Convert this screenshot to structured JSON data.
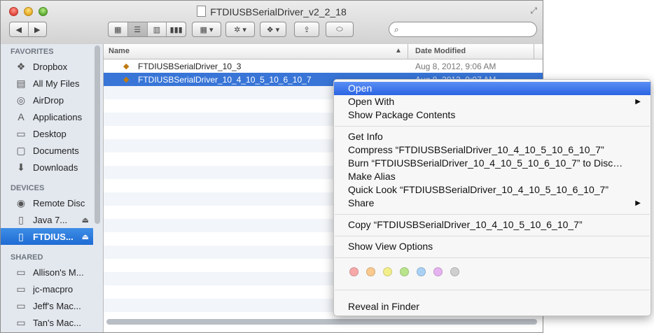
{
  "window": {
    "title": "FTDIUSBSerialDriver_v2_2_18"
  },
  "toolbar": {
    "back": "◀",
    "forward": "▶",
    "view_icon": "▦",
    "view_list": "☰",
    "view_column": "▥",
    "view_coverflow": "▮▮▮",
    "arrange": "▦ ▾",
    "action": "✲ ▾",
    "dropbox": "❖ ▾",
    "share": "⇪",
    "tags": "⬭",
    "search_placeholder": ""
  },
  "sidebar": {
    "favorites_header": "FAVORITES",
    "favorites": [
      {
        "label": "Dropbox",
        "icon": "❖"
      },
      {
        "label": "All My Files",
        "icon": "▤"
      },
      {
        "label": "AirDrop",
        "icon": "◎"
      },
      {
        "label": "Applications",
        "icon": "A"
      },
      {
        "label": "Desktop",
        "icon": "▭"
      },
      {
        "label": "Documents",
        "icon": "▢"
      },
      {
        "label": "Downloads",
        "icon": "⬇"
      }
    ],
    "devices_header": "DEVICES",
    "devices": [
      {
        "label": "Remote Disc",
        "icon": "◉",
        "eject": ""
      },
      {
        "label": "Java 7...",
        "icon": "▯",
        "eject": "⏏"
      },
      {
        "label": "FTDIUS...",
        "icon": "▯",
        "eject": "⏏"
      }
    ],
    "shared_header": "SHARED",
    "shared": [
      {
        "label": "Allison's M...",
        "icon": "▭"
      },
      {
        "label": "jc-macpro",
        "icon": "▭"
      },
      {
        "label": "Jeff's Mac...",
        "icon": "▭"
      },
      {
        "label": "Tan's Mac...",
        "icon": "▭"
      }
    ]
  },
  "list": {
    "col_name": "Name",
    "col_sort": "▲",
    "col_date": "Date Modified",
    "rows": [
      {
        "name": "FTDIUSBSerialDriver_10_3",
        "date": "Aug 8, 2012, 9:06 AM"
      },
      {
        "name": "FTDIUSBSerialDriver_10_4_10_5_10_6_10_7",
        "date": "Aug 8, 2012, 9:07 AM"
      }
    ]
  },
  "context_menu": {
    "open": "Open",
    "open_with": "Open With",
    "show_package": "Show Package Contents",
    "get_info": "Get Info",
    "compress": "Compress “FTDIUSBSerialDriver_10_4_10_5_10_6_10_7”",
    "burn": "Burn “FTDIUSBSerialDriver_10_4_10_5_10_6_10_7” to Disc…",
    "make_alias": "Make Alias",
    "quick_look": "Quick Look “FTDIUSBSerialDriver_10_4_10_5_10_6_10_7”",
    "share": "Share",
    "copy": "Copy “FTDIUSBSerialDriver_10_4_10_5_10_6_10_7”",
    "show_view_options": "Show View Options",
    "reveal": "Reveal in Finder",
    "submenu_arrow": "▶",
    "tag_colors": [
      "#f7a9a9",
      "#f9c98e",
      "#f2ef8a",
      "#b9e48c",
      "#a9d1f5",
      "#e5b3ef",
      "#cfcfcf"
    ]
  }
}
